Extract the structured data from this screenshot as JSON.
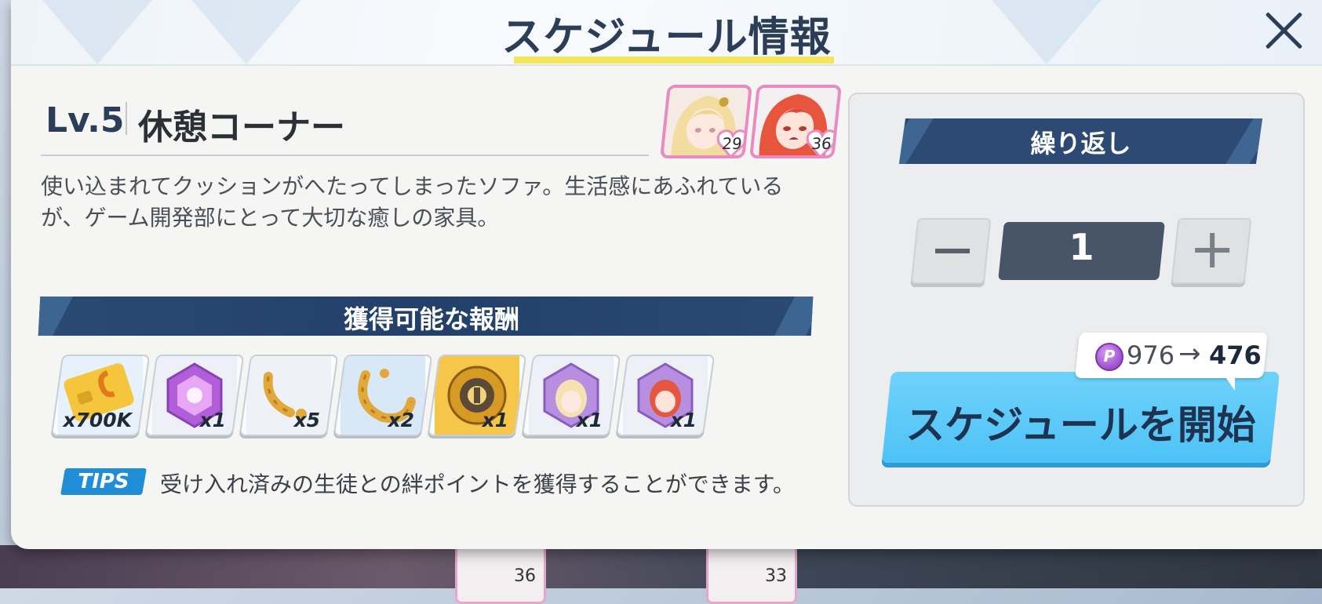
{
  "header": {
    "title": "スケジュール情報"
  },
  "location": {
    "level": "Lv.5",
    "name": "休憩コーナー",
    "description": "使い込まれてクッションがへたってしまったソファ。生活感にあふれているが、ゲーム開発部にとって大切な癒しの家具。"
  },
  "students": [
    {
      "name_icon": "student-portrait-blonde",
      "bond": "29"
    },
    {
      "name_icon": "student-portrait-redhead",
      "bond": "36"
    }
  ],
  "rewards": {
    "title": "獲得可能な報酬",
    "items": [
      {
        "icon": "credit-card-icon",
        "qty": "x700K"
      },
      {
        "icon": "purple-gem-icon",
        "qty": "x1"
      },
      {
        "icon": "gold-ring-fragment-small-icon",
        "qty": "x5"
      },
      {
        "icon": "gold-ring-fragment-large-icon",
        "qty": "x2"
      },
      {
        "icon": "gold-disc-icon",
        "qty": "x1"
      },
      {
        "icon": "student-gift-blonde-icon",
        "qty": "x1"
      },
      {
        "icon": "student-gift-redhead-icon",
        "qty": "x1"
      }
    ]
  },
  "tips": {
    "badge": "TIPS",
    "message": "受け入れ済みの生徒との絆ポイントを獲得することができます。"
  },
  "repeat": {
    "title": "繰り返し",
    "count": "1"
  },
  "cost": {
    "currency_symbol": "P",
    "from": "976",
    "arrow": "→",
    "to": "476"
  },
  "start_button": {
    "label": "スケジュールを開始"
  },
  "background_cards": [
    {
      "value": "36"
    },
    {
      "value": "33"
    }
  ],
  "colors": {
    "accent": "#2c4a73",
    "start_button": "#4ec2f6",
    "tips_badge": "#1f8ed6",
    "title_underline": "#f5e55a",
    "portrait_border": "#e98ac1"
  }
}
